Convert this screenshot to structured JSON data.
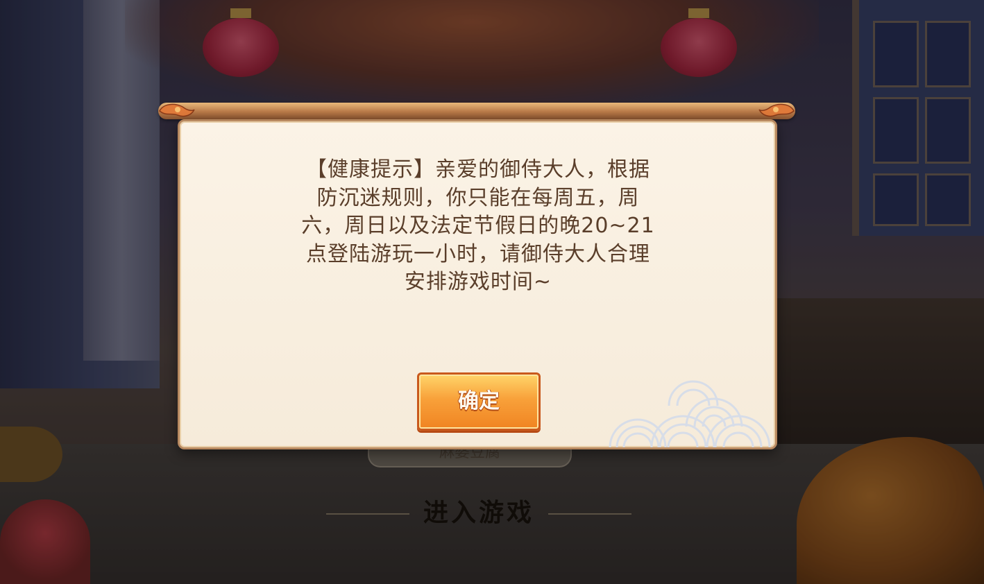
{
  "game": {
    "background_dish_label": "麻婆豆腐",
    "enter_game_label": "进入游戏"
  },
  "health_notice": {
    "lines": [
      "【健康提示】亲爱的御侍大人，根据",
      "防沉迷规则，你只能在每周五，周",
      "六，周日以及法定节假日的晚20~21",
      "点登陆游玩一小时，请御侍大人合理",
      "安排游戏时间~"
    ],
    "confirm_label": "确定"
  },
  "colors": {
    "dialog_text": "#5a3e2a",
    "button_orange": "#f8a13a",
    "frame_wood": "#b88960"
  }
}
